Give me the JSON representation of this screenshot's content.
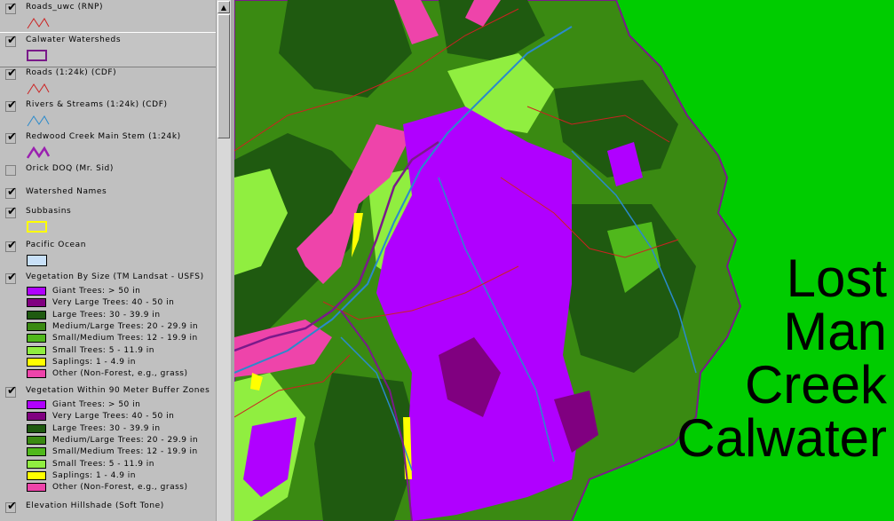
{
  "toc": {
    "layers": [
      {
        "name": "Roads_uwc (RNP)",
        "checked": true,
        "symbol": "red-line"
      },
      {
        "name": "Calwater Watersheds",
        "checked": true,
        "symbol": "purple-box",
        "active": true
      },
      {
        "name": "Roads (1:24k) (CDF)",
        "checked": true,
        "symbol": "red-line"
      },
      {
        "name": "Rivers & Streams (1:24k) (CDF)",
        "checked": true,
        "symbol": "blue-line"
      },
      {
        "name": "Redwood Creek Main Stem (1:24k)",
        "checked": true,
        "symbol": "magenta-line"
      },
      {
        "name": "Orick DOQ (Mr. Sid)",
        "checked": false
      },
      {
        "name": "Watershed Names",
        "checked": true
      },
      {
        "name": "Subbasins",
        "checked": true,
        "symbol": "yellow-box"
      },
      {
        "name": "Pacific Ocean",
        "checked": true,
        "symbol": "lightblue-box"
      },
      {
        "name": "Vegetation By Size (TM Landsat - USFS)",
        "checked": true,
        "classes": [
          {
            "label": "Giant Trees: > 50 in",
            "color": "#b000ff"
          },
          {
            "label": "Very Large Trees: 40 - 50 in",
            "color": "#800080"
          },
          {
            "label": "Large Trees: 30 - 39.9 in",
            "color": "#1f5a10"
          },
          {
            "label": "Medium/Large Trees: 20 - 29.9 in",
            "color": "#3a8a12"
          },
          {
            "label": "Small/Medium Trees: 12 - 19.9 in",
            "color": "#50b81c"
          },
          {
            "label": "Small Trees: 5 - 11.9 in",
            "color": "#90ee40"
          },
          {
            "label": "Saplings: 1 - 4.9 in",
            "color": "#ffff00"
          },
          {
            "label": "Other (Non-Forest, e.g., grass)",
            "color": "#ee44aa"
          }
        ]
      },
      {
        "name": "Vegetation Within 90 Meter Buffer Zones",
        "checked": true,
        "classes": [
          {
            "label": "Giant Trees: > 50 in",
            "color": "#b000ff"
          },
          {
            "label": "Very Large Trees: 40 - 50 in",
            "color": "#800080"
          },
          {
            "label": "Large Trees: 30 - 39.9 in",
            "color": "#1f5a10"
          },
          {
            "label": "Medium/Large Trees: 20 - 29.9 in",
            "color": "#3a8a12"
          },
          {
            "label": "Small/Medium Trees: 12 - 19.9 in",
            "color": "#50b81c"
          },
          {
            "label": "Small Trees: 5 - 11.9 in",
            "color": "#90ee40"
          },
          {
            "label": "Saplings: 1 - 4.9 in",
            "color": "#ffff00"
          },
          {
            "label": "Other (Non-Forest, e.g., grass)",
            "color": "#ee44aa"
          }
        ]
      },
      {
        "name": "Elevation Hillshade (Soft Tone)",
        "checked": true
      }
    ]
  },
  "map": {
    "title_lines": [
      "Lost",
      "Man",
      "Creek",
      "Calwater"
    ],
    "colors": {
      "background": "#00cc00",
      "giant": "#b000ff",
      "very_large": "#800080",
      "large": "#1f5a10",
      "medium_large": "#3a8a12",
      "small": "#90ee40",
      "other": "#ee44aa",
      "saplings": "#ffff00",
      "roads": "#cc2222",
      "streams": "#2a8acc",
      "watershed": "#7a1a8a"
    }
  }
}
